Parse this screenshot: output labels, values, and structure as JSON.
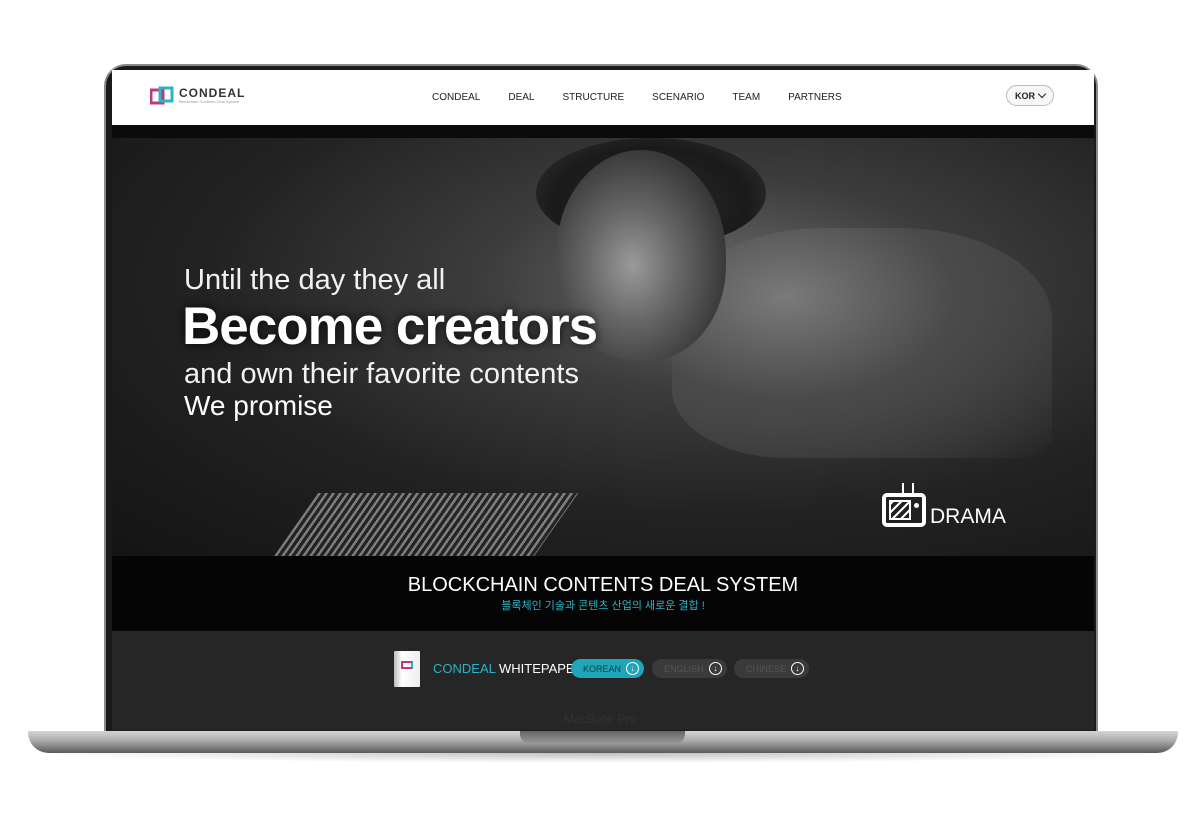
{
  "header": {
    "logo_name": "CONDEAL",
    "logo_sub": "Blockchain Contents Deal System",
    "nav": [
      "CONDEAL",
      "DEAL",
      "STRUCTURE",
      "SCENARIO",
      "TEAM",
      "PARTNERS"
    ],
    "language": "KOR"
  },
  "hero": {
    "line1": "Until the day they all",
    "line2": "Become creators",
    "line3": "and own their favorite contents",
    "line4": "We promise",
    "category_label": "DRAMA"
  },
  "band": {
    "title": "BLOCKCHAIN CONTENTS DEAL SYSTEM",
    "subtitle": "블록체인 기술과 콘텐츠 산업의 새로운 결합 !"
  },
  "whitepaper": {
    "brand": "CONDEAL",
    "doc": "WHITEPAPER",
    "buttons": [
      "KOREAN",
      "ENGLISH",
      "CHINESE"
    ],
    "accent_color": "#2bb3c6"
  },
  "device": {
    "label": "MacBook Pro"
  }
}
